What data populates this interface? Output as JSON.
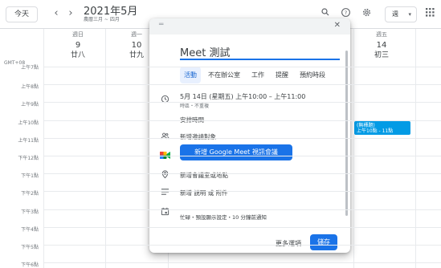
{
  "header": {
    "today": "今天",
    "prev": "‹",
    "next": "›",
    "month": "2021年5月",
    "lunar_range": "農曆三月 ~ 四月",
    "view": "週"
  },
  "timezone": "GMT+08",
  "days": [
    {
      "dow": "週日",
      "num": "9",
      "lunar": "廿八"
    },
    {
      "dow": "週一",
      "num": "10",
      "lunar": "廿九"
    },
    {
      "dow": "週五",
      "num": "14",
      "lunar": "初三"
    }
  ],
  "time_labels": [
    "上午7點",
    "上午8點",
    "上午9點",
    "上午10點",
    "上午11點",
    "下午12點",
    "下午1點",
    "下午2點",
    "下午3點",
    "下午4點",
    "下午5點",
    "下午6點"
  ],
  "event": {
    "title": "(無標題)",
    "time": "上午10點 - 11點"
  },
  "modal": {
    "title": "Meet 測試",
    "tabs": [
      "活動",
      "不在辦公室",
      "工作",
      "提醒",
      "預約時段"
    ],
    "date_line": "5月 14日 (星期五)   上午10:00  –  上午11:00",
    "sub_line": "時區・不重複",
    "find_time": "安排時間",
    "add_guests": "新增邀請對象",
    "meet_button": "新增 Google Meet 視訊會議",
    "location": "新增會議室或地點",
    "description": "新增 說明 或 附件",
    "calendar_info": "忙碌・預設顯示設定・10 分鐘前通知",
    "more_options": "更多選項",
    "save": "儲存"
  },
  "colors": {
    "accent": "#1a73e8",
    "event": "#039be5"
  }
}
